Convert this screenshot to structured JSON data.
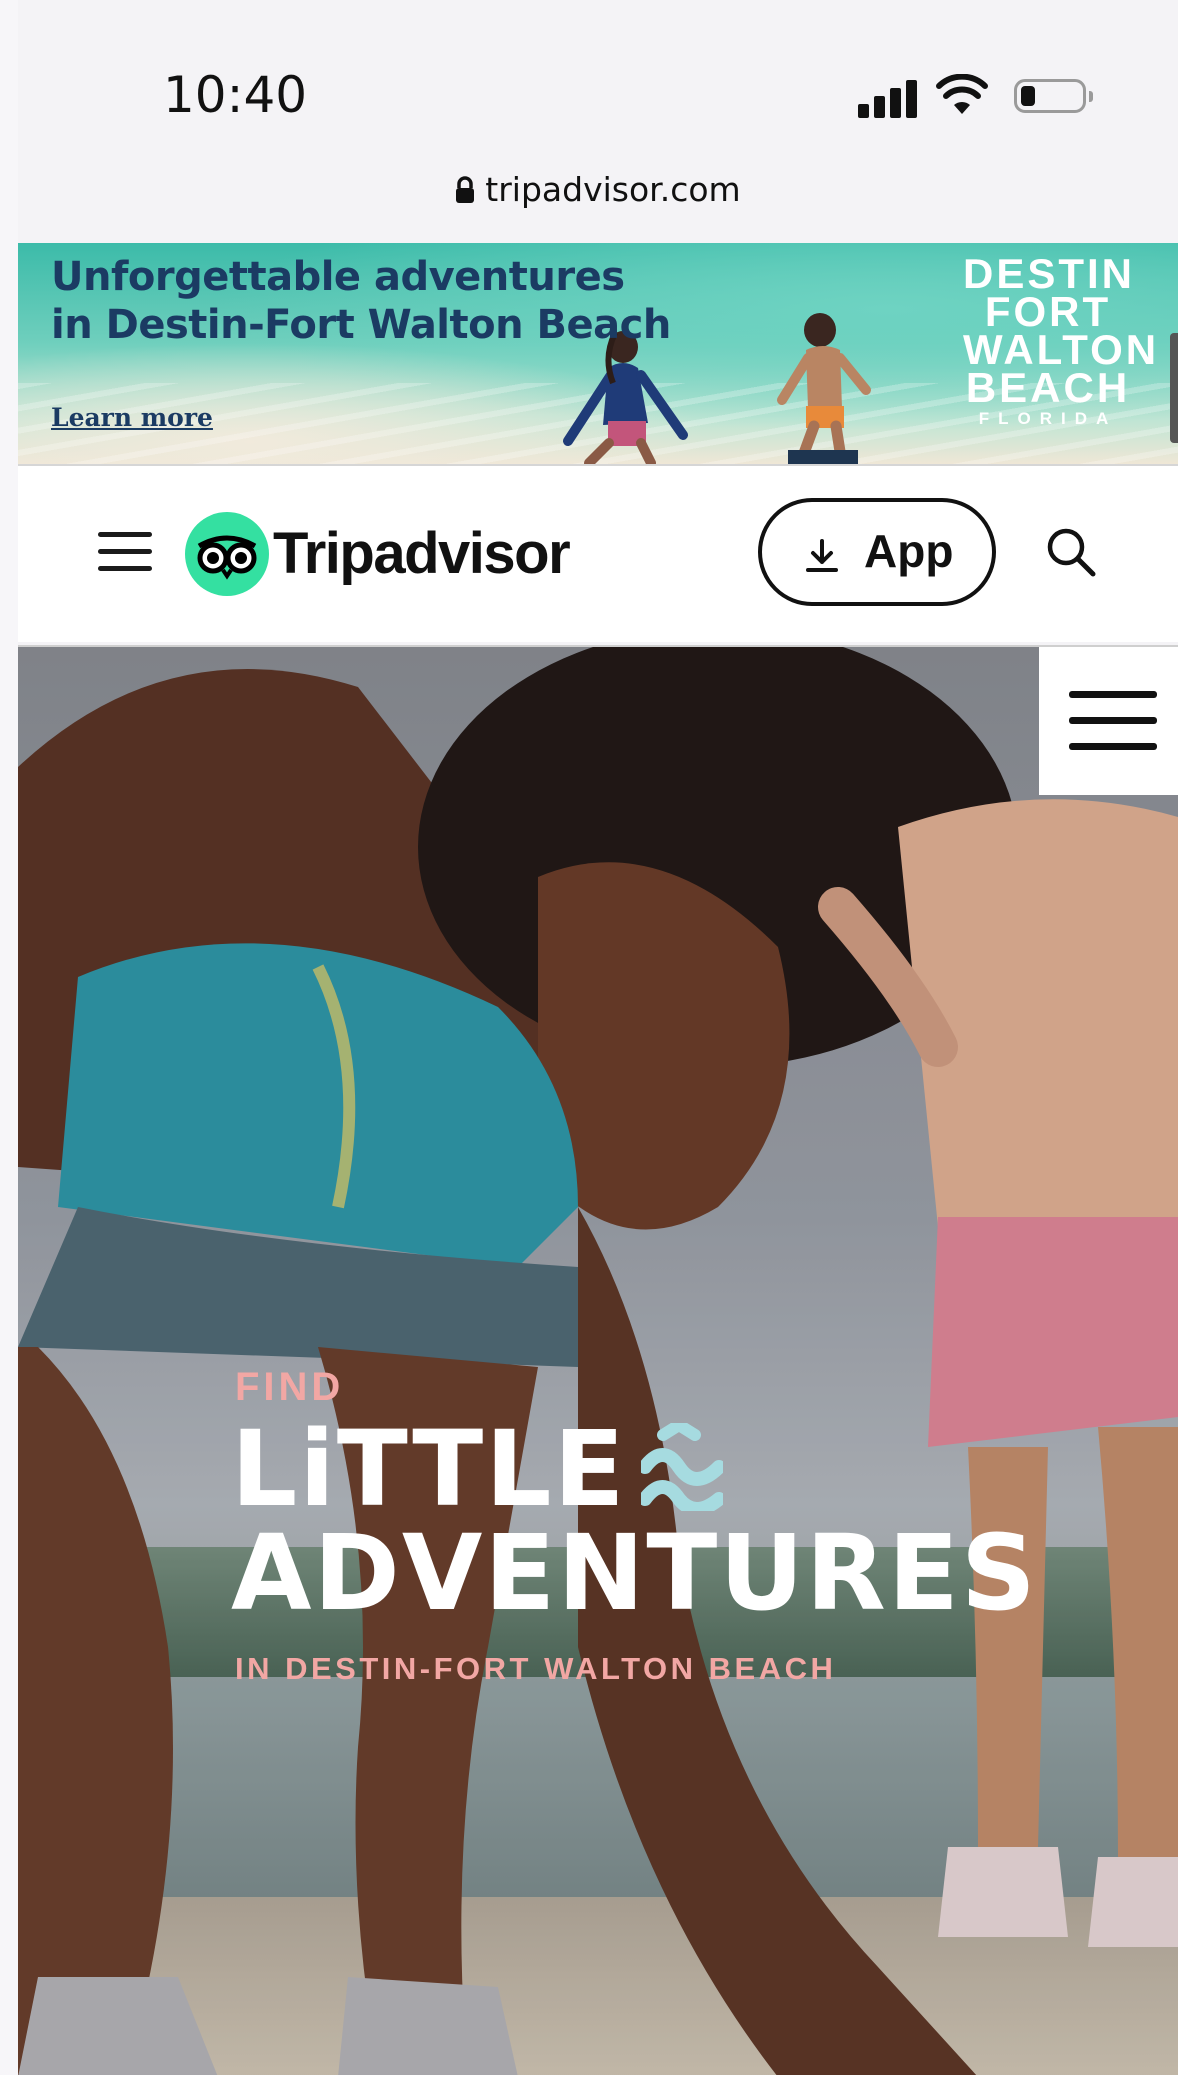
{
  "status_bar": {
    "time": "10:40"
  },
  "address_bar": {
    "url": "tripadvisor.com"
  },
  "ad_banner": {
    "headline_line1": "Unforgettable adventures",
    "headline_line2": "in Destin-Fort Walton Beach",
    "link_text": "Learn more",
    "logo_lines": [
      "DESTIN",
      "FORT",
      "WALTON",
      "BEACH"
    ],
    "logo_subline": "FLORIDA"
  },
  "header": {
    "brand": "Tripadvisor",
    "app_button_label": "App",
    "menu_icon": "hamburger-menu-icon",
    "search_icon": "search-icon",
    "brand_color": "#34e0a1"
  },
  "hero": {
    "overline": "FIND",
    "title_line1": "LiTTLE",
    "title_line2": "ADVENTURES",
    "subline": "IN DESTIN-FORT WALTON BEACH",
    "accent_color": "#f2a7a4",
    "wave_color": "#a6dbe0"
  }
}
